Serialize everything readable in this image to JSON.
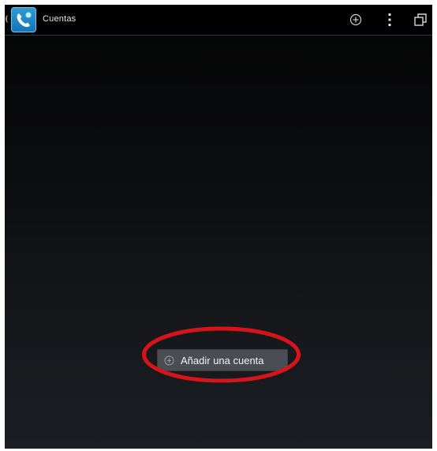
{
  "actionbar": {
    "title": "Cuentas",
    "app_icon": "phone-app-icon",
    "actions": [
      {
        "icon": "add-circle-icon"
      },
      {
        "icon": "overflow-menu-icon"
      },
      {
        "icon": "recent-apps-icon"
      }
    ]
  },
  "main": {
    "add_account_label": "Añadir una cuenta",
    "add_account_icon": "add-circle-icon"
  },
  "colors": {
    "annotation_ring": "#d8141b",
    "icon_blue": "#2e9bd6",
    "button_bg": "#4a4d52"
  }
}
